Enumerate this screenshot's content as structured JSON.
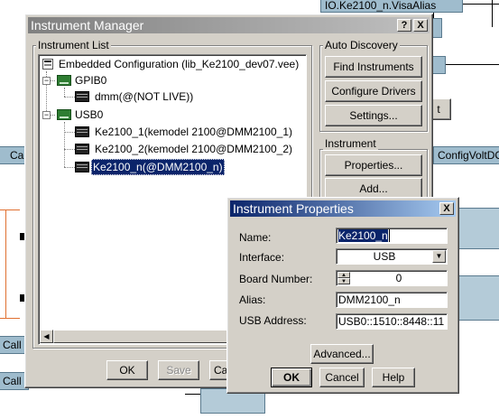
{
  "background": {
    "top_node": "IO.Ke2100_n.VisaAlias",
    "left_node_ca": "Ca",
    "right_node_config": "ConfigVoltDC",
    "call_1": "Call K",
    "call_2": "Call K",
    "partial_btn": "t"
  },
  "instrument_manager": {
    "title": "Instrument Manager",
    "help_btn": "?",
    "close_btn": "X",
    "list_group_label": "Instrument List",
    "tree": [
      {
        "label": "Embedded Configuration (lib_Ke2100_dev07.vee)",
        "icon": "config-icon"
      },
      {
        "label": "GPIB0",
        "icon": "card-icon",
        "expander": "-"
      },
      {
        "label": "dmm(@(NOT LIVE))",
        "icon": "device-icon"
      },
      {
        "label": "USB0",
        "icon": "card-icon",
        "expander": "-"
      },
      {
        "label": "Ke2100_1(kemodel 2100@DMM2100_1)",
        "icon": "device-icon"
      },
      {
        "label": "Ke2100_2(kemodel 2100@DMM2100_2)",
        "icon": "device-icon"
      },
      {
        "label": "Ke2100_n(@DMM2100_n)",
        "icon": "device-icon",
        "selected": true
      }
    ],
    "auto_discovery_label": "Auto Discovery",
    "find_instruments": "Find Instruments",
    "configure_drivers": "Configure Drivers",
    "settings": "Settings...",
    "instrument_group_label": "Instrument",
    "properties": "Properties...",
    "add": "Add...",
    "ok": "OK",
    "save": "Save",
    "cancel_partial": "Ca"
  },
  "instrument_properties": {
    "title": "Instrument Properties",
    "close_btn": "X",
    "name_label": "Name:",
    "name_value": "Ke2100_n",
    "interface_label": "Interface:",
    "interface_value": "USB",
    "board_label": "Board Number:",
    "board_value": "0",
    "alias_label": "Alias:",
    "alias_value": "DMM2100_n",
    "usb_label": "USB Address:",
    "usb_value": "USB0::1510::8448::11",
    "advanced": "Advanced...",
    "ok": "OK",
    "cancel": "Cancel",
    "help": "Help"
  },
  "colors": {
    "title_active_start": "#0a246a",
    "title_active_end": "#a6caf0",
    "title_inactive_start": "#808080",
    "title_inactive_end": "#c0c0c0"
  }
}
